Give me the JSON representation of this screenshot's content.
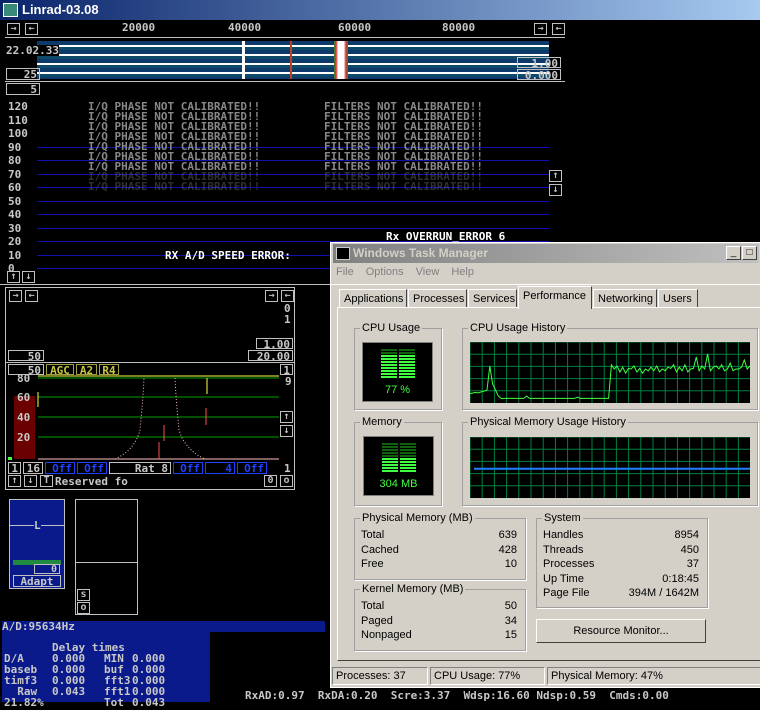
{
  "linrad": {
    "title": "Linrad-03.08",
    "freq_ticks": [
      "20000",
      "40000",
      "60000",
      "80000"
    ],
    "time": "22.02.33",
    "wf_left_value": "25",
    "wf_right_gain": "1.00",
    "wf_right_offset": "0.000",
    "avg_box": "5",
    "cal_warning_iq": "I/Q PHASE NOT CALIBRATED!!",
    "cal_warning_filters": "FILTERS NOT CALIBRATED!!",
    "spectrum_y_labels": [
      "120",
      "110",
      "100",
      "90",
      "80",
      "70",
      "60",
      "50",
      "40",
      "30",
      "20",
      "10",
      "0"
    ],
    "overrun_error": "Rx OVERRUN_ERROR 6",
    "ad_speed_error": "RX A/D SPEED ERROR:",
    "baseband": {
      "right_values": [
        "0",
        "1"
      ],
      "gain": "1.00",
      "scale": "20.00",
      "left_value": "50"
    },
    "agc": {
      "value": "50",
      "labels": [
        "AGC",
        "A2",
        "R4"
      ],
      "y_labels": [
        "80",
        "60",
        "40",
        "20"
      ],
      "right_top": "1",
      "right_second": "9",
      "controls": [
        "1",
        "16",
        "Off",
        "Off",
        "Rat   8",
        "Off",
        "4",
        "Off"
      ],
      "right_bottom": "1",
      "reserved": "Reserved fo",
      "zero": "0",
      "o": "o"
    },
    "smeter": {
      "l": "L",
      "value": "0",
      "adapt": "Adapt",
      "s": "s",
      "o": "o"
    },
    "ad_rate": "A/D:95634Hz",
    "delay": {
      "title": "Delay times",
      "rows": [
        [
          "D/A",
          "0.000",
          "MIN",
          "0.000"
        ],
        [
          "baseb",
          "0.000",
          "buf",
          "0.000"
        ],
        [
          "timf3",
          "0.000",
          "fft3",
          "0.000"
        ],
        [
          "  Raw",
          "0.043",
          "fft1",
          "0.000"
        ],
        [
          "21.82%",
          "",
          "Tot",
          "0.043"
        ]
      ]
    },
    "stats": "RxAD:0.97  RxDA:0.20  Scre:3.37  Wdsp:16.60 Ndsp:0.59  Cmds:0.00"
  },
  "taskmgr": {
    "title": "Windows Task Manager",
    "menu": [
      "File",
      "Options",
      "View",
      "Help"
    ],
    "tabs": [
      "Applications",
      "Processes",
      "Services",
      "Performance",
      "Networking",
      "Users"
    ],
    "active_tab": "Performance",
    "cpu_label": "CPU Usage",
    "cpu_value": "77 %",
    "cpu_percent": 77,
    "cpu_hist_label": "CPU Usage History",
    "cpu_history": [
      14,
      15,
      16,
      15,
      17,
      18,
      20,
      60,
      30,
      20,
      10,
      6,
      6,
      6,
      6,
      6,
      6,
      6,
      6,
      6,
      10,
      6,
      6,
      6,
      6,
      6,
      6,
      6,
      6,
      6,
      6,
      6,
      6,
      6,
      6,
      6,
      6,
      6,
      8,
      6,
      6,
      6,
      6,
      6,
      6,
      6,
      6,
      6,
      6,
      6,
      62,
      55,
      60,
      50,
      58,
      48,
      56,
      55,
      60,
      50,
      56,
      48,
      55,
      52,
      58,
      52,
      60,
      50,
      55,
      52,
      58,
      56,
      62,
      50,
      58,
      52,
      62,
      50,
      55,
      56,
      75,
      52,
      60,
      55,
      80,
      52,
      58,
      60,
      55,
      62,
      52,
      55,
      65,
      52,
      55,
      55,
      58,
      70,
      55,
      60
    ],
    "mem_label": "Memory",
    "mem_value": "304 MB",
    "mem_hist_label": "Physical Memory Usage History",
    "mem_history_percent": 47,
    "physical": {
      "label": "Physical Memory (MB)",
      "rows": [
        [
          "Total",
          "639"
        ],
        [
          "Cached",
          "428"
        ],
        [
          "Free",
          "10"
        ]
      ]
    },
    "kernel": {
      "label": "Kernel Memory (MB)",
      "rows": [
        [
          "Total",
          "50"
        ],
        [
          "Paged",
          "34"
        ],
        [
          "Nonpaged",
          "15"
        ]
      ]
    },
    "system": {
      "label": "System",
      "rows": [
        [
          "Handles",
          "8954"
        ],
        [
          "Threads",
          "450"
        ],
        [
          "Processes",
          "37"
        ],
        [
          "Up Time",
          "0:18:45"
        ],
        [
          "Page File",
          "394M / 1642M"
        ]
      ]
    },
    "resource_monitor": "Resource Monitor...",
    "status": [
      "Processes: 37",
      "CPU Usage: 77%",
      "Physical Memory: 47%"
    ]
  }
}
